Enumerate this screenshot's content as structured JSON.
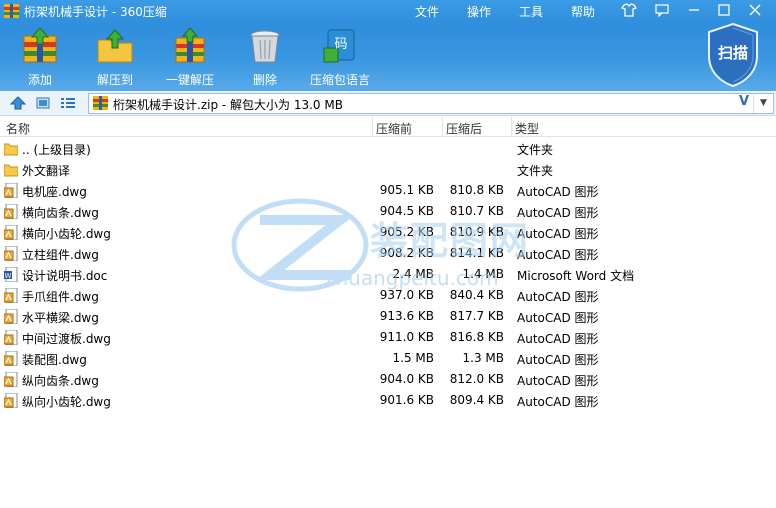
{
  "window": {
    "title": "桁架机械手设计 - 360压缩",
    "menu": [
      "文件",
      "操作",
      "工具",
      "帮助"
    ],
    "controls": [
      "skin-icon",
      "feedback-icon",
      "minimize-icon",
      "maximize-icon",
      "close-icon"
    ]
  },
  "toolbar": {
    "items": [
      {
        "label": "添加",
        "icon": "add-archive-icon"
      },
      {
        "label": "解压到",
        "icon": "extract-to-icon"
      },
      {
        "label": "一键解压",
        "icon": "one-click-extract-icon"
      },
      {
        "label": "删除",
        "icon": "delete-icon"
      },
      {
        "label": "压缩包语言",
        "icon": "archive-language-icon"
      }
    ],
    "scan_label": "扫描",
    "language_badge": "码"
  },
  "address": {
    "text": "桁架机械手设计.zip - 解包大小为 13.0 MB",
    "v_label": "V"
  },
  "columns": {
    "name": "名称",
    "before": "压缩前",
    "after": "压缩后",
    "type": "类型"
  },
  "files": [
    {
      "name": ".. (上级目录)",
      "before": "",
      "after": "",
      "type": "文件夹",
      "icon": "folder-icon"
    },
    {
      "name": "外文翻译",
      "before": "",
      "after": "",
      "type": "文件夹",
      "icon": "folder-icon"
    },
    {
      "name": "电机座.dwg",
      "before": "905.1 KB",
      "after": "810.8 KB",
      "type": "AutoCAD 图形",
      "icon": "dwg-file-icon"
    },
    {
      "name": "横向齿条.dwg",
      "before": "904.5 KB",
      "after": "810.7 KB",
      "type": "AutoCAD 图形",
      "icon": "dwg-file-icon"
    },
    {
      "name": "横向小齿轮.dwg",
      "before": "905.2 KB",
      "after": "810.9 KB",
      "type": "AutoCAD 图形",
      "icon": "dwg-file-icon"
    },
    {
      "name": "立柱组件.dwg",
      "before": "908.2 KB",
      "after": "814.1 KB",
      "type": "AutoCAD 图形",
      "icon": "dwg-file-icon"
    },
    {
      "name": "设计说明书.doc",
      "before": "2.4 MB",
      "after": "1.4 MB",
      "type": "Microsoft Word 文档",
      "icon": "word-file-icon"
    },
    {
      "name": "手爪组件.dwg",
      "before": "937.0 KB",
      "after": "840.4 KB",
      "type": "AutoCAD 图形",
      "icon": "dwg-file-icon"
    },
    {
      "name": "水平横梁.dwg",
      "before": "913.6 KB",
      "after": "817.7 KB",
      "type": "AutoCAD 图形",
      "icon": "dwg-file-icon"
    },
    {
      "name": "中间过渡板.dwg",
      "before": "911.0 KB",
      "after": "816.8 KB",
      "type": "AutoCAD 图形",
      "icon": "dwg-file-icon"
    },
    {
      "name": "装配图.dwg",
      "before": "1.5 MB",
      "after": "1.3 MB",
      "type": "AutoCAD 图形",
      "icon": "dwg-file-icon"
    },
    {
      "name": "纵向齿条.dwg",
      "before": "904.0 KB",
      "after": "812.0 KB",
      "type": "AutoCAD 图形",
      "icon": "dwg-file-icon"
    },
    {
      "name": "纵向小齿轮.dwg",
      "before": "901.6 KB",
      "after": "809.4 KB",
      "type": "AutoCAD 图形",
      "icon": "dwg-file-icon"
    }
  ],
  "watermark": {
    "cn": "装配图网",
    "en": "zhuangpeitu.com"
  },
  "colors": {
    "accent": "#2f8edd",
    "header_bg": "#3b9be5",
    "shield": "#2a6fc0"
  }
}
